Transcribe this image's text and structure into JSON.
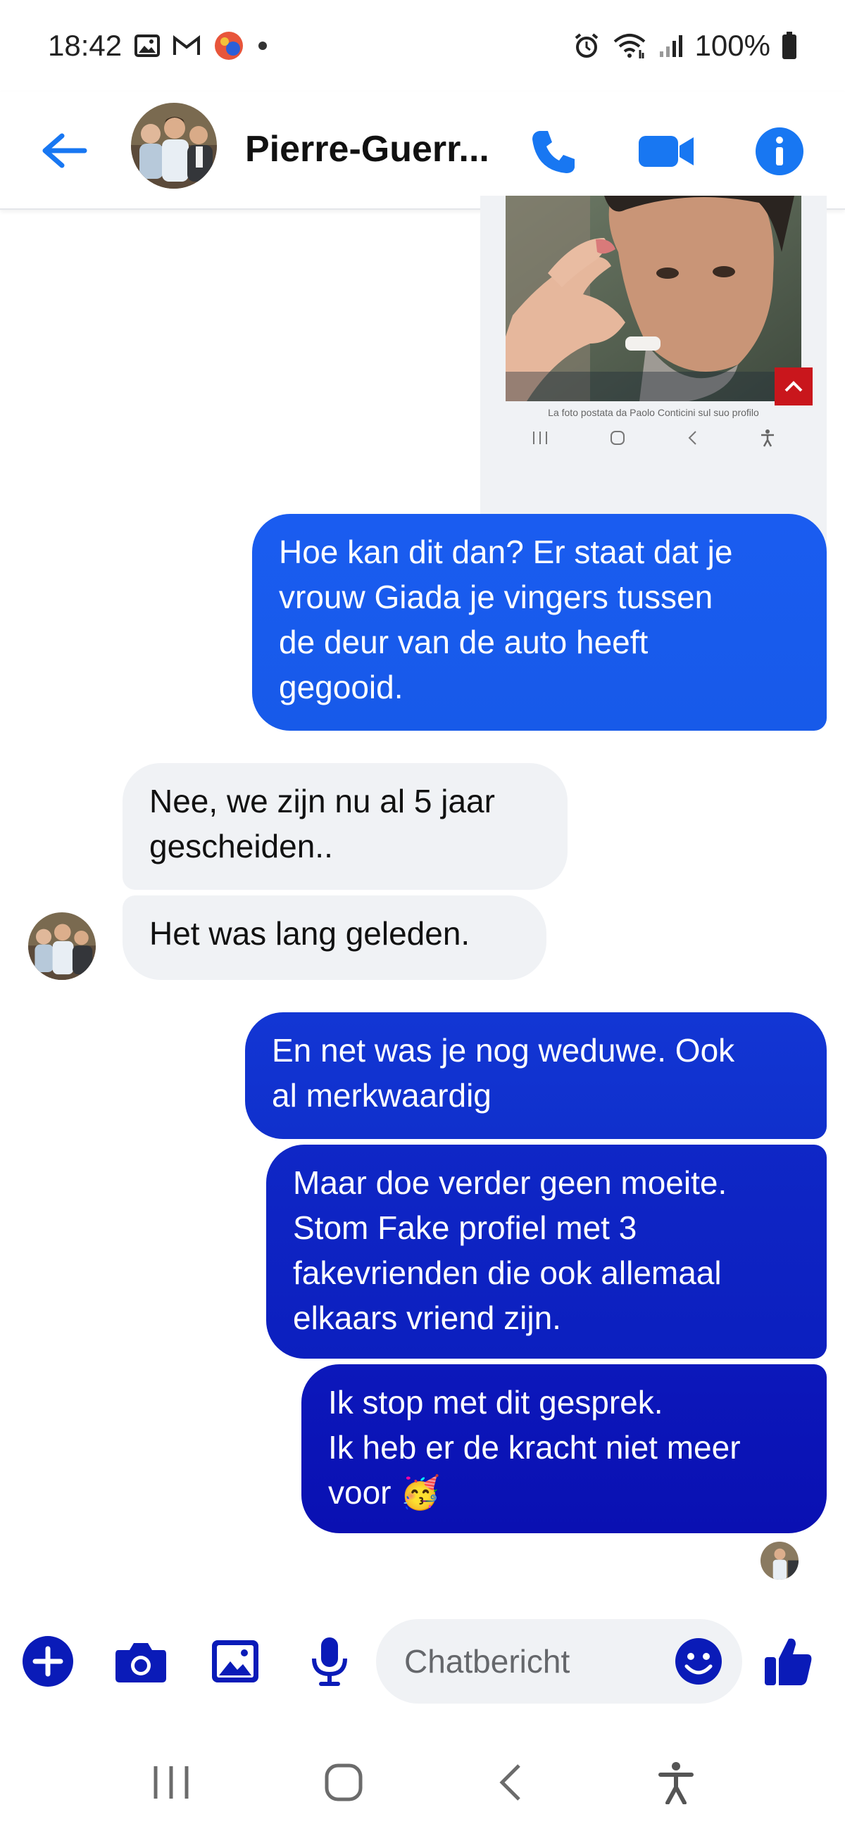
{
  "status_bar": {
    "time": "18:42",
    "battery": "100%",
    "icons_left": [
      "gallery-icon",
      "gmail-icon",
      "app-badge-icon",
      "dot-icon"
    ],
    "icons_right": [
      "alarm-icon",
      "wifi-icon",
      "signal-icon",
      "battery-icon"
    ]
  },
  "header": {
    "contact_name": "Pierre-Guerr...",
    "accent_color": "#1877f2",
    "buttons": [
      "back-arrow-icon",
      "phone-icon",
      "video-camera-icon",
      "info-icon"
    ]
  },
  "shared_image": {
    "caption": "La foto postata da Paolo Conticini sul suo profilo"
  },
  "messages": [
    {
      "direction": "outgoing",
      "text": "Hoe kan dit dan? Er staat dat je\nvrouw Giada je vingers tussen\nde deur van de auto heeft\ngegooid."
    },
    {
      "direction": "incoming",
      "text": "Nee, we zijn nu al 5 jaar\ngescheiden.."
    },
    {
      "direction": "incoming",
      "text": "Het was lang geleden."
    },
    {
      "direction": "outgoing",
      "text": "En net was je nog weduwe. Ook\nal merkwaardig"
    },
    {
      "direction": "outgoing",
      "text": "Maar doe verder geen moeite.\nStom Fake profiel met 3\nfakevrienden die ook allemaal\nelkaars vriend zijn."
    },
    {
      "direction": "outgoing",
      "text": "Ik stop met dit gesprek.\nIk heb er de kracht niet meer\nvoor 🥳"
    }
  ],
  "composer": {
    "placeholder": "Chatbericht",
    "buttons": [
      "plus-icon",
      "camera-icon",
      "gallery-icon",
      "microphone-icon",
      "emoji-icon",
      "thumbs-up-icon"
    ],
    "icon_color": "#0a1bb8"
  },
  "colors": {
    "outgoing_gradient_top": "#1a5cf0",
    "outgoing_gradient_bottom": "#0d0fb0",
    "incoming_bg": "#f0f2f5"
  }
}
